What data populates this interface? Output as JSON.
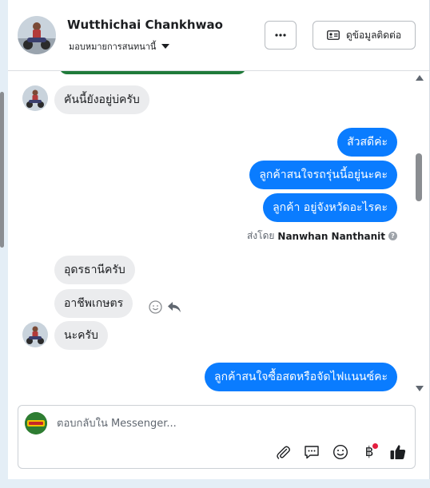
{
  "header": {
    "name": "Wutthichai Chankhwao",
    "assign_label": "มอบหมายการสนทนานี้",
    "contact_button": "ดูข้อมูลติดต่อ"
  },
  "messages": [
    {
      "id": "m1",
      "dir": "in",
      "text": "คันนี้ยังอยู่บ่ครับ"
    },
    {
      "id": "m2",
      "dir": "out",
      "text": "สัวสดีค่ะ"
    },
    {
      "id": "m3",
      "dir": "out",
      "text": "ลูกค้าสนใจรถรุ่นนี้อยู่นะคะ"
    },
    {
      "id": "m4",
      "dir": "out",
      "text": "ลูกค้า อยู่จังหวัดอะไรคะ"
    },
    {
      "id": "m5",
      "dir": "in",
      "text": "อุดรธานีครับ"
    },
    {
      "id": "m6",
      "dir": "in",
      "text": "อาชีพเกษตร"
    },
    {
      "id": "m7",
      "dir": "in",
      "text": "นะครับ"
    },
    {
      "id": "m8",
      "dir": "out",
      "text": "ลูกค้าสนใจซื้อสดหรือจัดไฟแนนซ์คะ"
    }
  ],
  "sent_by": {
    "prefix": "ส่งโดย",
    "agent": "Nanwhan Nanthanit",
    "help": "?"
  },
  "composer": {
    "placeholder": "ตอบกลับใน Messenger...",
    "baht_symbol": "฿"
  },
  "colors": {
    "outgoing": "#0a7cff",
    "incoming": "#ebecee",
    "badge": "#e41e3f"
  },
  "icons": [
    "more-icon",
    "contact-card-icon",
    "chevron-down-icon",
    "smiley-icon",
    "reply-icon",
    "paperclip-icon",
    "comment-icon",
    "emoji-icon",
    "baht-icon",
    "like-icon"
  ]
}
